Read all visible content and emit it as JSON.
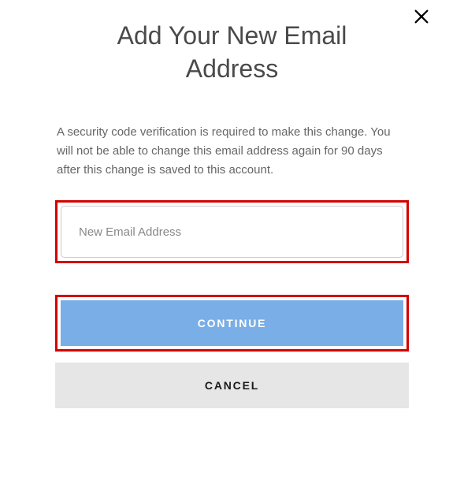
{
  "modal": {
    "title": "Add Your New Email Address",
    "description": "A security code verification is required to make this change. You will not be able to change this email address again for 90 days after this change is saved to this account.",
    "email_placeholder": "New Email Address",
    "continue_label": "CONTINUE",
    "cancel_label": "CANCEL"
  }
}
